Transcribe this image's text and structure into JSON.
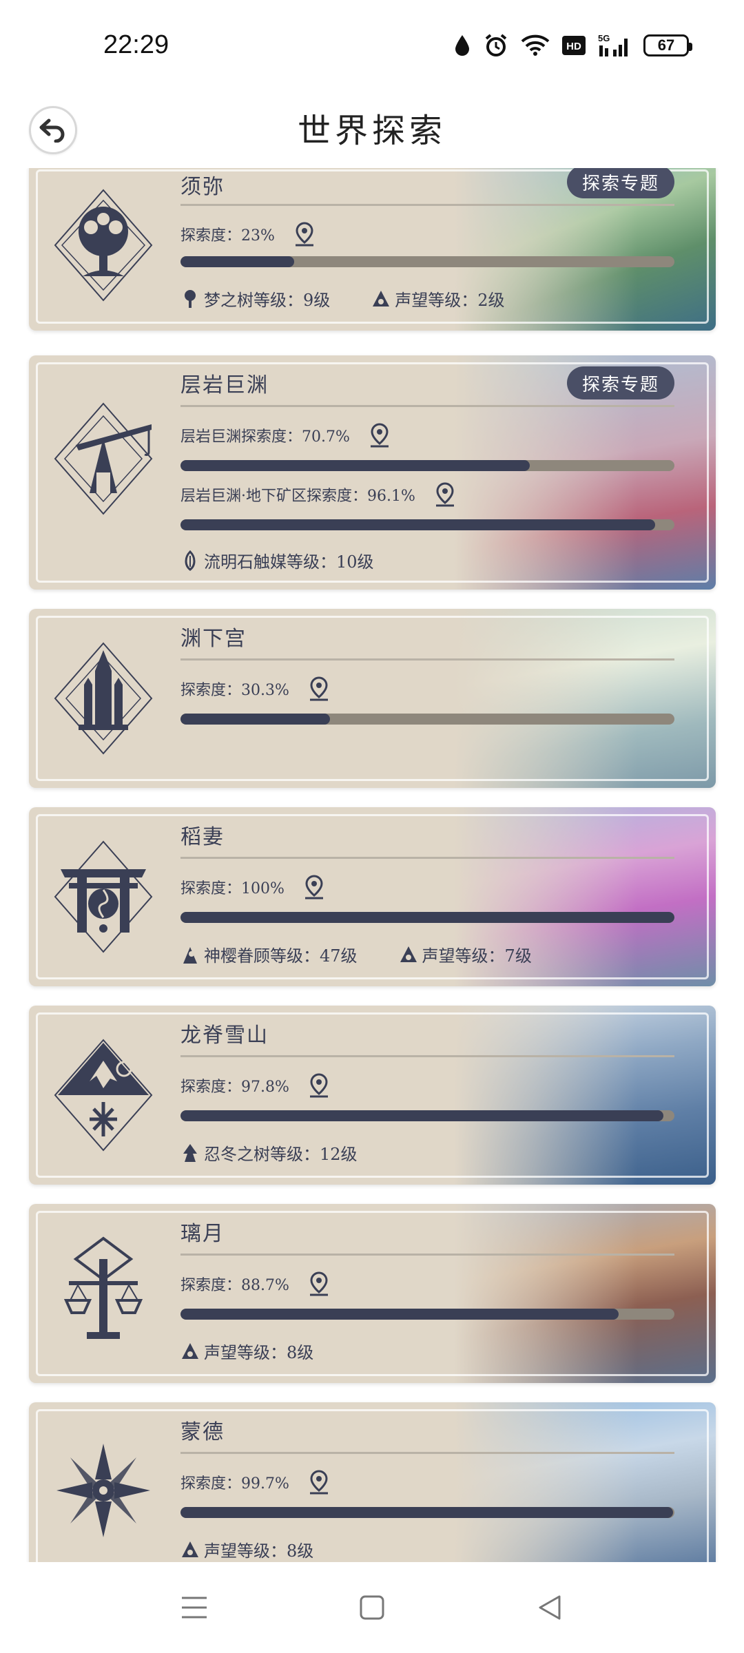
{
  "status": {
    "time": "22:29",
    "battery": "67",
    "network": "5G"
  },
  "header": {
    "title": "世界探索"
  },
  "colors": {
    "accent": "#3a3f55",
    "card": "#e0d7c8",
    "bar_track": "#8e877c"
  },
  "regions": [
    {
      "name": "须弥",
      "topic": "探索专题",
      "stats": [
        {
          "label": "探索度：23%",
          "progress": 0.23
        }
      ],
      "levels": [
        {
          "icon": "dream-tree-icon",
          "label": "梦之树等级：9级"
        },
        {
          "icon": "reputation-icon",
          "label": "声望等级：2级"
        }
      ]
    },
    {
      "name": "层岩巨渊",
      "topic": "探索专题",
      "stats": [
        {
          "label": "层岩巨渊探索度：70.7%",
          "progress": 0.707
        },
        {
          "label": "层岩巨渊·地下矿区探索度：96.1%",
          "progress": 0.961
        }
      ],
      "levels": [
        {
          "icon": "lumenstone-icon",
          "label": "流明石触媒等级：10级"
        }
      ]
    },
    {
      "name": "渊下宫",
      "stats": [
        {
          "label": "探索度：30.3%",
          "progress": 0.303
        }
      ],
      "levels": []
    },
    {
      "name": "稻妻",
      "stats": [
        {
          "label": "探索度：100%",
          "progress": 1.0
        }
      ],
      "levels": [
        {
          "icon": "sacred-sakura-icon",
          "label": "神樱眷顾等级：47级"
        },
        {
          "icon": "reputation-icon",
          "label": "声望等级：7级"
        }
      ]
    },
    {
      "name": "龙脊雪山",
      "stats": [
        {
          "label": "探索度：97.8%",
          "progress": 0.978
        }
      ],
      "levels": [
        {
          "icon": "frostbearing-tree-icon",
          "label": "忍冬之树等级：12级"
        }
      ]
    },
    {
      "name": "璃月",
      "stats": [
        {
          "label": "探索度：88.7%",
          "progress": 0.887
        }
      ],
      "levels": [
        {
          "icon": "reputation-icon",
          "label": "声望等级：8级"
        }
      ]
    },
    {
      "name": "蒙德",
      "stats": [
        {
          "label": "探索度：99.7%",
          "progress": 0.997
        }
      ],
      "levels": [
        {
          "icon": "reputation-icon",
          "label": "声望等级：8级"
        }
      ]
    }
  ]
}
